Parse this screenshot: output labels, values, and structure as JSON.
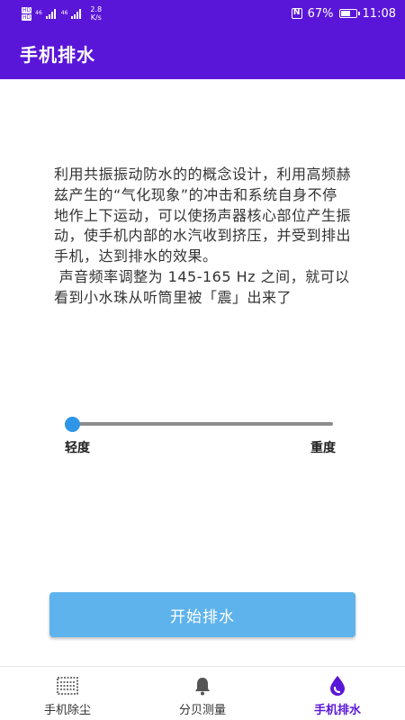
{
  "status_bar": {
    "network_left": "46",
    "network_right": "46",
    "speed_value": "2.8",
    "speed_unit": "K/s",
    "nfc": "N",
    "battery": "67%",
    "battery_level": 0.67,
    "time": "11:08"
  },
  "app_bar": {
    "title": "手机排水"
  },
  "main": {
    "description": "利用共振振动防水的的概念设计，利用高频赫兹产生的“气化现象”的冲击和系统自身不停地作上下运动，可以使扬声器核心部位产生振动，使手机内部的水汽收到挤压，并受到排出手机，达到排水的效果。\n 声音频率调整为 145-165 Hz 之间，就可以看到小水珠从听筒里被「震」出来了",
    "slider": {
      "label_low": "轻度",
      "label_high": "重度",
      "value": 0.0,
      "thumb_color": "#2f95e6"
    },
    "start_button_label": "开始排水"
  },
  "bottom_nav": {
    "items": [
      {
        "label": "手机除尘",
        "icon": "speaker-grille-icon",
        "active": false
      },
      {
        "label": "分贝测量",
        "icon": "bell-icon",
        "active": false
      },
      {
        "label": "手机排水",
        "icon": "water-drop-icon",
        "active": true
      }
    ]
  },
  "colors": {
    "primary": "#5a16d8",
    "button": "#5fb3ec"
  }
}
